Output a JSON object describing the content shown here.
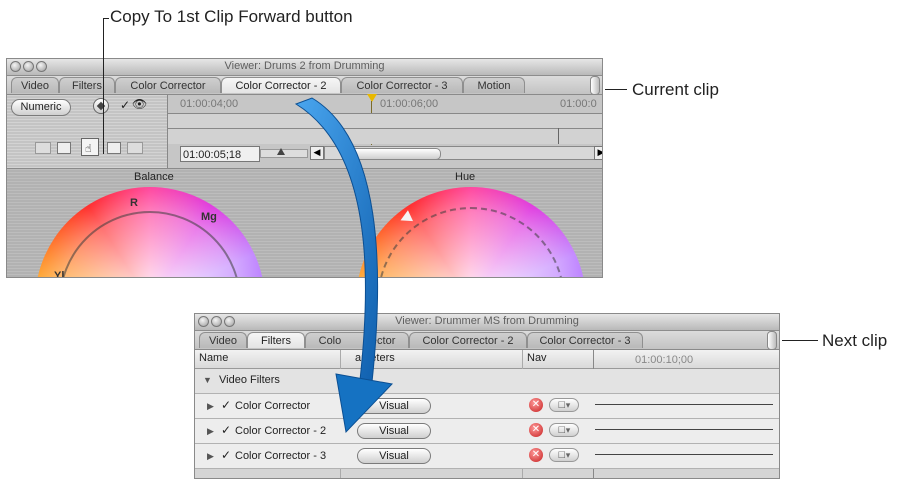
{
  "callouts": {
    "copy_forward": "Copy To 1st Clip Forward button",
    "current_clip": "Current clip",
    "next_clip": "Next clip"
  },
  "viewer1": {
    "title": "Viewer: Drums 2 from Drumming",
    "tabs": [
      "Video",
      "Filters",
      "Color Corrector",
      "Color Corrector - 2",
      "Color Corrector - 3",
      "Motion"
    ],
    "active_tab": "Color Corrector - 2",
    "numeric_button": "Numeric",
    "timecodes": [
      "01:00:04;00",
      "01:00:06;00",
      "01:00:0"
    ],
    "current_timecode": "01:00:05;18",
    "balance_label": "Balance",
    "hue_label": "Hue",
    "wheel_labels": {
      "r": "R",
      "mg": "Mg",
      "yl": "Yl"
    }
  },
  "viewer2": {
    "title": "Viewer: Drummer MS from Drumming",
    "tabs": [
      "Video",
      "Filters",
      "Color Corrector",
      "Color Corrector - 2",
      "Color Corrector - 3"
    ],
    "tab_display": [
      "Video",
      "Filters",
      "Colo",
      "rector",
      "Color Corrector - 2",
      "Color Corrector - 3"
    ],
    "active_tab": "Filters",
    "columns": {
      "name": "Name",
      "parameters": "ameters",
      "nav": "Nav",
      "timecode": "01:00:10;00"
    },
    "group": "Video Filters",
    "rows": [
      {
        "name": "Color Corrector",
        "button": "Visual"
      },
      {
        "name": "Color Corrector - 2",
        "button": "Visual"
      },
      {
        "name": "Color Corrector - 3",
        "button": "Visual"
      }
    ]
  },
  "colors": {
    "arrow": "#1d7fd0",
    "tab_active": "#efefef",
    "window_bg": "#c9c9c9"
  }
}
